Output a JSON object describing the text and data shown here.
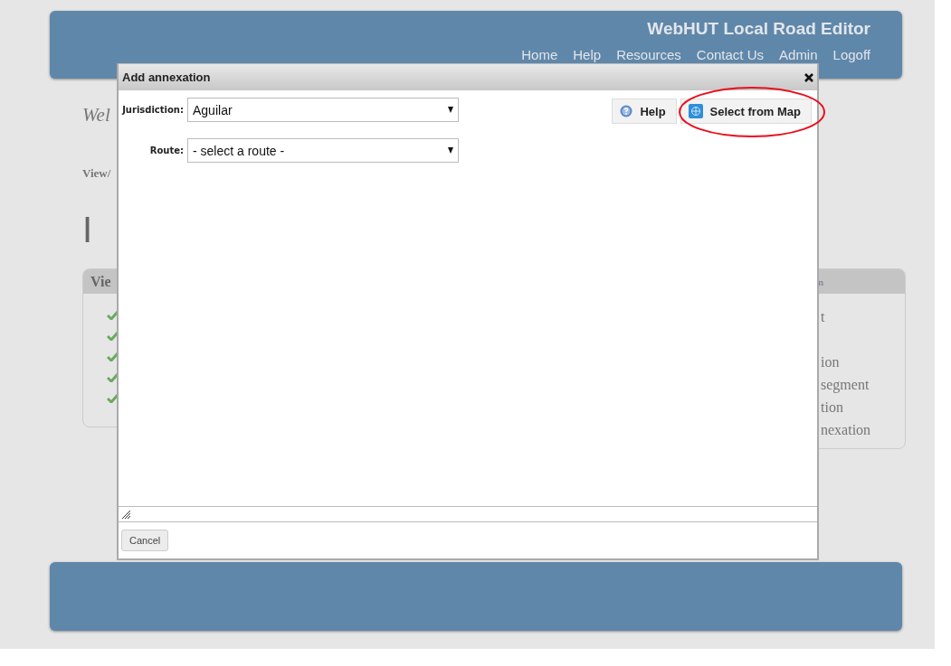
{
  "header": {
    "title": "WebHUT Local Road Editor",
    "nav": [
      "Home",
      "Help",
      "Resources",
      "Contact Us",
      "Admin",
      "Logoff"
    ]
  },
  "background": {
    "welcome": "Wel",
    "breadcrumb": "View/",
    "heading": "I",
    "left_panel": {
      "title": "Vie"
    },
    "right_panel": {
      "title": "n",
      "items": [
        "t",
        "ion",
        "segment",
        "tion",
        "nexation"
      ]
    }
  },
  "dialog": {
    "title": "Add annexation",
    "fields": [
      {
        "label": "Jurisdiction:",
        "value": "Aguilar"
      },
      {
        "label": "Route:",
        "value": "- select a route -"
      }
    ],
    "buttons": [
      {
        "kind": "help",
        "label": "Help",
        "highlighted": false
      },
      {
        "kind": "map",
        "label": "Select from Map",
        "highlighted": true
      }
    ],
    "cancel": "Cancel"
  }
}
